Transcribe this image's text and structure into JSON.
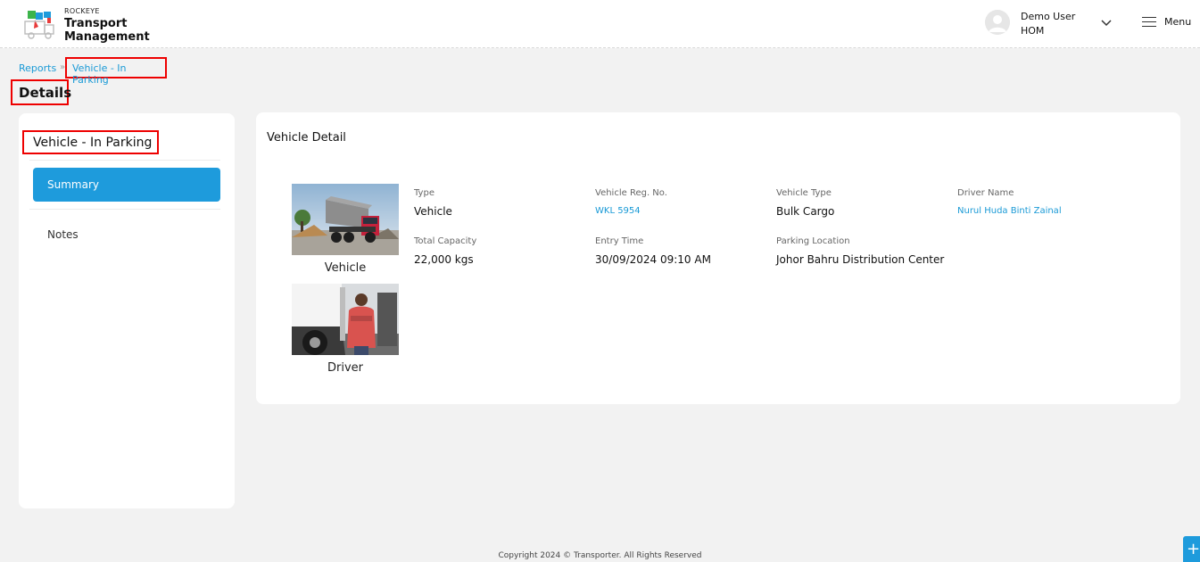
{
  "header": {
    "brand_small": "ROCKEYE",
    "brand_line1": "Transport",
    "brand_line2": "Management",
    "user_name": "Demo User",
    "user_code": "HOM",
    "menu_label": "Menu"
  },
  "breadcrumb": {
    "reports": "Reports",
    "separator": "»",
    "current": "Vehicle - In Parking"
  },
  "page_title": "Details",
  "sidebar": {
    "title": "Vehicle - In Parking",
    "items": [
      {
        "label": "Summary",
        "active": true
      },
      {
        "label": "Notes",
        "active": false
      }
    ]
  },
  "detail": {
    "title": "Vehicle Detail",
    "photos": [
      {
        "caption": "Vehicle",
        "icon": "dump-truck-photo"
      },
      {
        "caption": "Driver",
        "icon": "driver-photo"
      }
    ],
    "fields": {
      "type": {
        "label": "Type",
        "value": "Vehicle"
      },
      "reg_no": {
        "label": "Vehicle Reg. No.",
        "value": "WKL 5954"
      },
      "vehicle_type": {
        "label": "Vehicle Type",
        "value": "Bulk Cargo"
      },
      "driver_name": {
        "label": "Driver Name",
        "value": "Nurul Huda Binti Zainal"
      },
      "total_capacity": {
        "label": "Total Capacity",
        "value": "22,000 kgs"
      },
      "entry_time": {
        "label": "Entry Time",
        "value": "30/09/2024 09:10 AM"
      },
      "parking_location": {
        "label": "Parking Location",
        "value": "Johor Bahru Distribution Center"
      }
    }
  },
  "footer": "Copyright 2024 © Transporter. All Rights Reserved",
  "fab_icon": "+",
  "colors": {
    "accent": "#1e9bdc",
    "highlight": "#ee0000"
  }
}
